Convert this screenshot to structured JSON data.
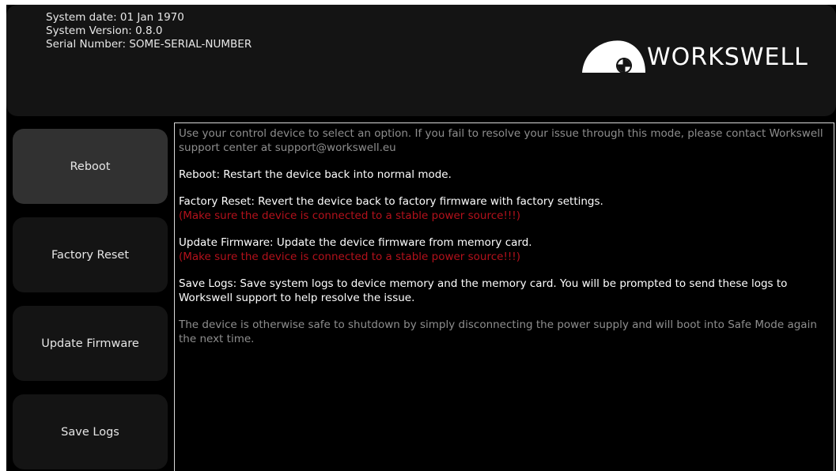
{
  "header": {
    "system_date": "System date: 01 Jan 1970",
    "system_version": "System Version: 0.8.0",
    "serial_number": "Serial Number: SOME-SERIAL-NUMBER",
    "logo_text": "WORKSWELL"
  },
  "sidebar": {
    "items": [
      {
        "label": "Reboot"
      },
      {
        "label": "Factory Reset"
      },
      {
        "label": "Update Firmware"
      },
      {
        "label": "Save Logs"
      }
    ]
  },
  "info": {
    "intro": "Use your control device to select an option. If you fail to resolve your issue through this mode, please contact Workswell support center at support@workswell.eu",
    "reboot": "Reboot: Restart the device back into normal mode.",
    "factory_reset": "Factory Reset: Revert the device back to factory firmware with factory settings.",
    "factory_reset_warning": "(Make sure the device is connected to a stable power source!!!)",
    "update_firmware": "Update Firmware: Update the device firmware from memory card.",
    "update_firmware_warning": "(Make sure the device is connected to a stable power source!!!)",
    "save_logs": "Save Logs: Save system logs to device memory and the memory card. You will be prompted to send these logs to Workswell support to help resolve the issue.",
    "shutdown_note": "The device is otherwise safe to shutdown by simply disconnecting the power supply and will boot into Safe Mode again the next time."
  },
  "colors": {
    "background": "#000000",
    "header_bg": "#141414",
    "button_bg": "#141414",
    "button_active_bg": "#313131",
    "text": "#ffffff",
    "muted_text": "#8e8e8e",
    "warning_text": "#b3111b"
  }
}
